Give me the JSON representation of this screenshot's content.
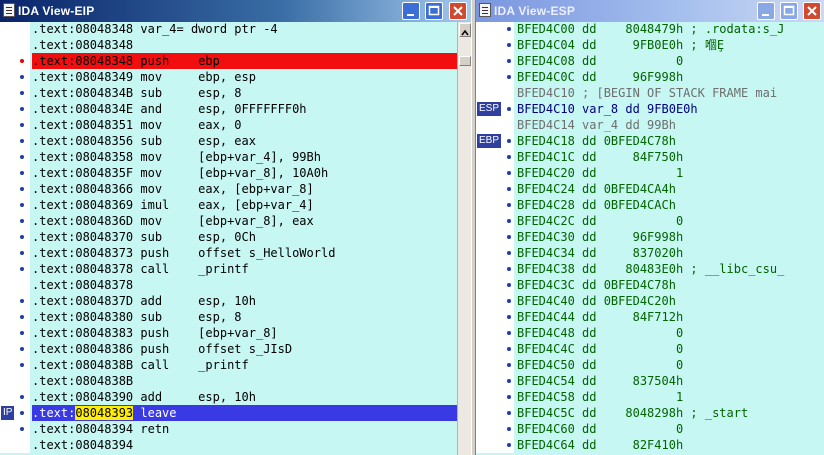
{
  "eip_view": {
    "title": "IDA View-EIP",
    "lines": [
      {
        "text": ".text:08048348 var_4= dword ptr -4",
        "dot": ""
      },
      {
        "text": ".text:08048348",
        "dot": ""
      },
      {
        "text": ".text:08048348 push    ebp",
        "dot": "red",
        "highlight": "breakpoint"
      },
      {
        "text": ".text:08048349 mov     ebp, esp",
        "dot": "blue"
      },
      {
        "text": ".text:0804834B sub     esp, 8",
        "dot": "blue"
      },
      {
        "text": ".text:0804834E and     esp, 0FFFFFFF0h",
        "dot": "blue"
      },
      {
        "text": ".text:08048351 mov     eax, 0",
        "dot": "blue"
      },
      {
        "text": ".text:08048356 sub     esp, eax",
        "dot": "blue"
      },
      {
        "text": ".text:08048358 mov     [ebp+var_4], 99Bh",
        "dot": "blue"
      },
      {
        "text": ".text:0804835F mov     [ebp+var_8], 10A0h",
        "dot": "blue"
      },
      {
        "text": ".text:08048366 mov     eax, [ebp+var_8]",
        "dot": "blue"
      },
      {
        "text": ".text:08048369 imul    eax, [ebp+var_4]",
        "dot": "blue"
      },
      {
        "text": ".text:0804836D mov     [ebp+var_8], eax",
        "dot": "blue"
      },
      {
        "text": ".text:08048370 sub     esp, 0Ch",
        "dot": "blue"
      },
      {
        "text": ".text:08048373 push    offset s_HelloWorld",
        "dot": "blue"
      },
      {
        "text": ".text:08048378 call    _printf",
        "dot": "blue"
      },
      {
        "text": ".text:08048378",
        "dot": ""
      },
      {
        "text": ".text:0804837D add     esp, 10h",
        "dot": "blue"
      },
      {
        "text": ".text:08048380 sub     esp, 8",
        "dot": "blue"
      },
      {
        "text": ".text:08048383 push    [ebp+var_8]",
        "dot": "blue"
      },
      {
        "text": ".text:08048386 push    offset s_JIsD",
        "dot": "blue"
      },
      {
        "text": ".text:0804838B call    _printf",
        "dot": "blue"
      },
      {
        "text": ".text:0804838B",
        "dot": ""
      },
      {
        "text": ".text:08048390 add     esp, 10h",
        "dot": "blue"
      },
      {
        "text_prefix": ".text:",
        "text_addr": "08048393",
        "text_rest": " leave",
        "dot": "blue",
        "highlight": "ip",
        "badge": "IP"
      },
      {
        "text": ".text:08048394 retn",
        "dot": "blue"
      },
      {
        "text": ".text:08048394",
        "dot": ""
      }
    ]
  },
  "esp_view": {
    "title": "IDA View-ESP",
    "lines": [
      {
        "text": "BFED4C00 dd    8048479h ; .rodata:s_J",
        "dot": "blue",
        "tone": "green"
      },
      {
        "text": "BFED4C04 dd     9FB0E0h ; 嗰Ȩ",
        "dot": "blue",
        "tone": "green"
      },
      {
        "text": "BFED4C08 dd           0",
        "dot": "blue",
        "tone": "green"
      },
      {
        "text": "BFED4C0C dd     96F998h",
        "dot": "blue",
        "tone": "green"
      },
      {
        "text": "BFED4C10 ; [BEGIN OF STACK FRAME mai",
        "dot": "",
        "tone": "grey"
      },
      {
        "text": "BFED4C10 var_8 dd 9FB0E0h",
        "dot": "blue",
        "tone": "navy",
        "badge": "ESP"
      },
      {
        "text": "BFED4C14 var_4 dd 99Bh",
        "dot": "",
        "tone": "grey"
      },
      {
        "text": "BFED4C18 dd 0BFED4C78h",
        "dot": "blue",
        "tone": "green",
        "badge": "EBP"
      },
      {
        "text": "BFED4C1C dd     84F750h",
        "dot": "blue",
        "tone": "green"
      },
      {
        "text": "BFED4C20 dd           1",
        "dot": "blue",
        "tone": "green"
      },
      {
        "text": "BFED4C24 dd 0BFED4CA4h",
        "dot": "blue",
        "tone": "green"
      },
      {
        "text": "BFED4C28 dd 0BFED4CACh",
        "dot": "blue",
        "tone": "green"
      },
      {
        "text": "BFED4C2C dd           0",
        "dot": "blue",
        "tone": "green"
      },
      {
        "text": "BFED4C30 dd     96F998h",
        "dot": "blue",
        "tone": "green"
      },
      {
        "text": "BFED4C34 dd     837020h",
        "dot": "blue",
        "tone": "green"
      },
      {
        "text": "BFED4C38 dd    80483E0h ; __libc_csu_",
        "dot": "blue",
        "tone": "green"
      },
      {
        "text": "BFED4C3C dd 0BFED4C78h",
        "dot": "blue",
        "tone": "green"
      },
      {
        "text": "BFED4C40 dd 0BFED4C20h",
        "dot": "blue",
        "tone": "green"
      },
      {
        "text": "BFED4C44 dd     84F712h",
        "dot": "blue",
        "tone": "green"
      },
      {
        "text": "BFED4C48 dd           0",
        "dot": "blue",
        "tone": "green"
      },
      {
        "text": "BFED4C4C dd           0",
        "dot": "blue",
        "tone": "green"
      },
      {
        "text": "BFED4C50 dd           0",
        "dot": "blue",
        "tone": "green"
      },
      {
        "text": "BFED4C54 dd     837504h",
        "dot": "blue",
        "tone": "green"
      },
      {
        "text": "BFED4C58 dd           1",
        "dot": "blue",
        "tone": "green"
      },
      {
        "text": "BFED4C5C dd    8048298h ; _start",
        "dot": "blue",
        "tone": "green"
      },
      {
        "text": "BFED4C60 dd           0",
        "dot": "blue",
        "tone": "green"
      },
      {
        "text": "BFED4C64 dd     82F410h",
        "dot": "blue",
        "tone": "green"
      }
    ]
  },
  "icons": {
    "window_icon": "document-icon",
    "minimize": "minimize-icon",
    "maximize": "maximize-icon",
    "close": "close-icon"
  },
  "colors": {
    "code_bg": "#c7f7f3",
    "breakpoint_line": "#f20e0e",
    "ip_line": "#3a3ae4",
    "ip_address": "#ffee00"
  }
}
